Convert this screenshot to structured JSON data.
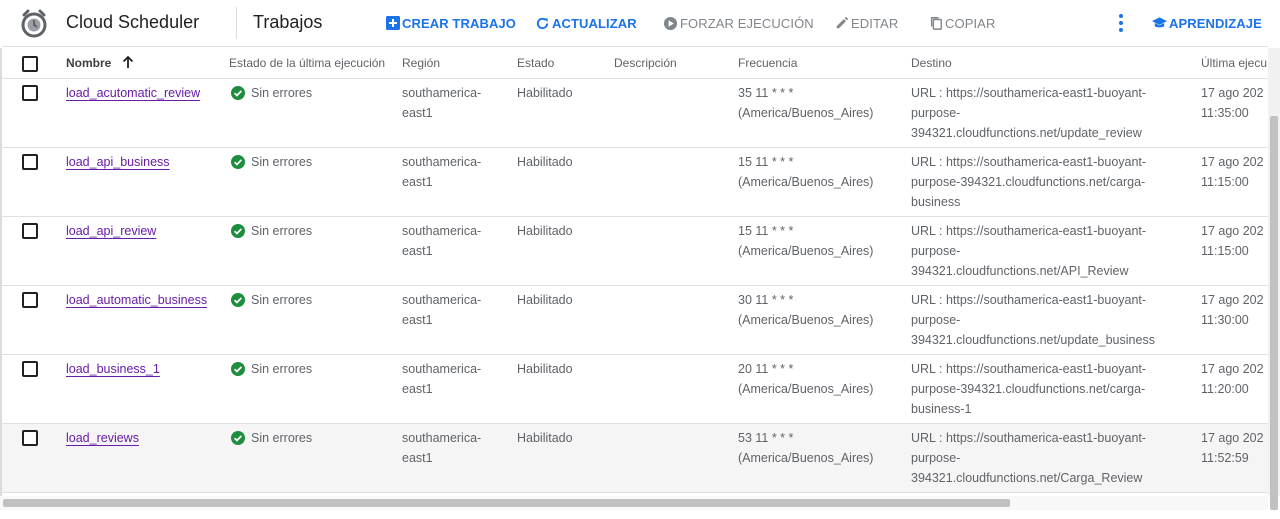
{
  "header": {
    "app_title": "Cloud Scheduler",
    "page_title": "Trabajos",
    "actions": {
      "create": "CREAR TRABAJO",
      "refresh": "ACTUALIZAR",
      "force_run": "FORZAR EJECUCIÓN",
      "edit": "EDITAR",
      "copy": "COPIAR",
      "learn": "APRENDIZAJE"
    },
    "icons": {
      "logo": "cloud-scheduler-clock-icon",
      "create": "add-box-icon",
      "refresh": "refresh-icon",
      "force_run": "play-circle-icon",
      "edit": "pencil-icon",
      "copy": "copy-icon",
      "more": "more-vert-icon",
      "learn": "graduation-cap-icon"
    }
  },
  "colors": {
    "accent": "#1a73e8",
    "link_visited": "#681da8",
    "success": "#1e8e3e",
    "disabled": "#80868b"
  },
  "table": {
    "columns": {
      "name": "Nombre",
      "last_run": "Estado de la última ejecución",
      "region": "Región",
      "state": "Estado",
      "description": "Descripción",
      "frequency": "Frecuencia",
      "target": "Destino",
      "last_exec": "Última ejecu"
    },
    "sort": {
      "column": "Nombre",
      "direction": "ascending"
    },
    "rows": [
      {
        "name": "load_acutomatic_review",
        "last_run": "Sin errores",
        "region_1": "southamerica-",
        "region_2": "east1",
        "state": "Habilitado",
        "description": "",
        "freq_1": "35 11 * * *",
        "freq_2": "(America/Buenos_Aires)",
        "target_1": "URL : https://southamerica-east1-buoyant-",
        "target_2": "purpose-",
        "target_3": "394321.cloudfunctions.net/update_review",
        "last_exec_1": "17 ago 202",
        "last_exec_2": "11:35:00"
      },
      {
        "name": "load_api_business",
        "last_run": "Sin errores",
        "region_1": "southamerica-",
        "region_2": "east1",
        "state": "Habilitado",
        "description": "",
        "freq_1": "15 11 * * *",
        "freq_2": "(America/Buenos_Aires)",
        "target_1": "URL : https://southamerica-east1-buoyant-",
        "target_2": "purpose-394321.cloudfunctions.net/carga-",
        "target_3": "business",
        "last_exec_1": "17 ago 202",
        "last_exec_2": "11:15:00"
      },
      {
        "name": "load_api_review",
        "last_run": "Sin errores",
        "region_1": "southamerica-",
        "region_2": "east1",
        "state": "Habilitado",
        "description": "",
        "freq_1": "15 11 * * *",
        "freq_2": "(America/Buenos_Aires)",
        "target_1": "URL : https://southamerica-east1-buoyant-",
        "target_2": "purpose-",
        "target_3": "394321.cloudfunctions.net/API_Review",
        "last_exec_1": "17 ago 202",
        "last_exec_2": "11:15:00"
      },
      {
        "name": "load_automatic_business",
        "last_run": "Sin errores",
        "region_1": "southamerica-",
        "region_2": "east1",
        "state": "Habilitado",
        "description": "",
        "freq_1": "30 11 * * *",
        "freq_2": "(America/Buenos_Aires)",
        "target_1": "URL : https://southamerica-east1-buoyant-",
        "target_2": "purpose-",
        "target_3": "394321.cloudfunctions.net/update_business",
        "last_exec_1": "17 ago 202",
        "last_exec_2": "11:30:00"
      },
      {
        "name": "load_business_1",
        "last_run": "Sin errores",
        "region_1": "southamerica-",
        "region_2": "east1",
        "state": "Habilitado",
        "description": "",
        "freq_1": "20 11 * * *",
        "freq_2": "(America/Buenos_Aires)",
        "target_1": "URL : https://southamerica-east1-buoyant-",
        "target_2": "purpose-394321.cloudfunctions.net/carga-",
        "target_3": "business-1",
        "last_exec_1": "17 ago 202",
        "last_exec_2": "11:20:00"
      },
      {
        "name": "load_reviews",
        "last_run": "Sin errores",
        "region_1": "southamerica-",
        "region_2": "east1",
        "state": "Habilitado",
        "description": "",
        "freq_1": "53 11 * * *",
        "freq_2": "(America/Buenos_Aires)",
        "target_1": "URL : https://southamerica-east1-buoyant-",
        "target_2": "purpose-",
        "target_3": "394321.cloudfunctions.net/Carga_Review",
        "last_exec_1": "17 ago 202",
        "last_exec_2": "11:52:59"
      }
    ]
  }
}
